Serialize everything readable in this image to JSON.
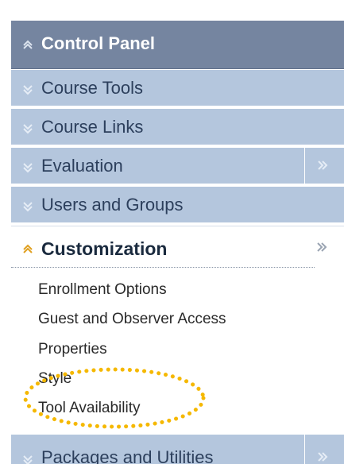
{
  "control_panel": {
    "title": "Control Panel",
    "menu": [
      {
        "label": "Course Tools"
      },
      {
        "label": "Course Links"
      },
      {
        "label": "Evaluation"
      },
      {
        "label": "Users and Groups"
      }
    ],
    "active": {
      "label": "Customization",
      "submenu": [
        {
          "label": "Enrollment Options"
        },
        {
          "label": "Guest and Observer Access"
        },
        {
          "label": "Properties"
        },
        {
          "label": "Style"
        },
        {
          "label": "Tool Availability"
        }
      ]
    },
    "bottom_item": {
      "label": "Packages and Utilities"
    }
  },
  "colors": {
    "header_bg": "#7585a0",
    "item_bg": "#b4c6dd",
    "item_text": "#2c3f5c",
    "highlight_circle": "#f5b800",
    "active_chevron": "#e0a020"
  }
}
